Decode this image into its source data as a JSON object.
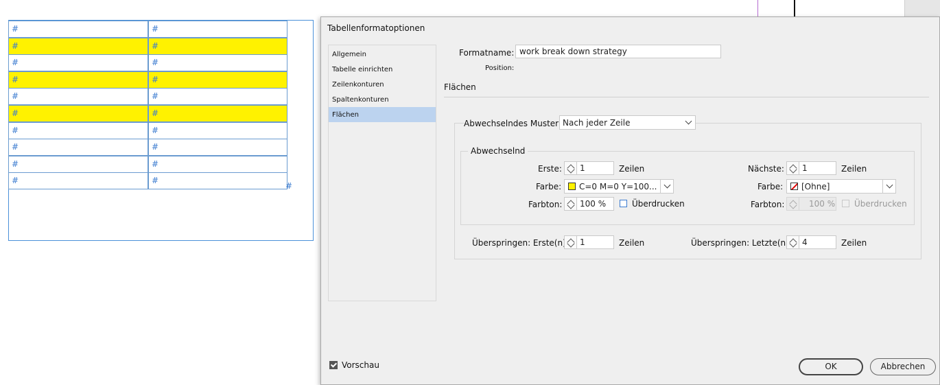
{
  "document": {
    "cell_marker": "#",
    "rows": [
      {
        "cells": [
          "#",
          "#"
        ],
        "highlight": false
      },
      {
        "cells": [
          "#",
          "#"
        ],
        "highlight": true
      },
      {
        "cells": [
          "#",
          "#"
        ],
        "highlight": false
      },
      {
        "cells": [
          "#",
          "#"
        ],
        "highlight": true
      },
      {
        "cells": [
          "#",
          "#"
        ],
        "highlight": false
      },
      {
        "cells": [
          "#",
          "#"
        ],
        "highlight": true
      },
      {
        "cells": [
          "#",
          "#"
        ],
        "highlight": false
      },
      {
        "cells": [
          "#",
          "#"
        ],
        "highlight": false
      },
      {
        "cells": [
          "#",
          "#"
        ],
        "highlight": false
      },
      {
        "cells": [
          "#",
          "#"
        ],
        "highlight": false
      }
    ],
    "overset_marker": "#",
    "highlight_color": "#fff200"
  },
  "dialog": {
    "title": "Tabellenformatoptionen",
    "nav": [
      {
        "label": "Allgemein",
        "selected": false
      },
      {
        "label": "Tabelle einrichten",
        "selected": false
      },
      {
        "label": "Zeilenkonturen",
        "selected": false
      },
      {
        "label": "Spaltenkonturen",
        "selected": false
      },
      {
        "label": "Flächen",
        "selected": true
      }
    ],
    "formatname_label": "Formatname:",
    "formatname_value": "work break down strategy",
    "position_label": "Position:",
    "section_title": "Flächen",
    "pattern_label": "Abwechselndes Muster:",
    "pattern_value": "Nach jeder Zeile",
    "alternating_legend": "Abwechselnd",
    "first": {
      "count_label": "Erste:",
      "count_value": "1",
      "count_unit": "Zeilen",
      "color_label": "Farbe:",
      "color_value": "C=0 M=0 Y=100...",
      "color_swatch": "#fff200",
      "tint_label": "Farbton:",
      "tint_value": "100 %",
      "overprint_label": "Überdrucken"
    },
    "next": {
      "count_label": "Nächste:",
      "count_value": "1",
      "count_unit": "Zeilen",
      "color_label": "Farbe:",
      "color_value": "[Ohne]",
      "tint_label": "Farbton:",
      "tint_value": "100 %",
      "overprint_label": "Überdrucken"
    },
    "skip_first_label": "Überspringen: Erste(n)",
    "skip_first_value": "1",
    "skip_first_unit": "Zeilen",
    "skip_last_label": "Überspringen: Letzte(n)",
    "skip_last_value": "4",
    "skip_last_unit": "Zeilen",
    "preview_label": "Vorschau",
    "preview_checked": true,
    "ok_label": "OK",
    "cancel_label": "Abbrechen"
  }
}
